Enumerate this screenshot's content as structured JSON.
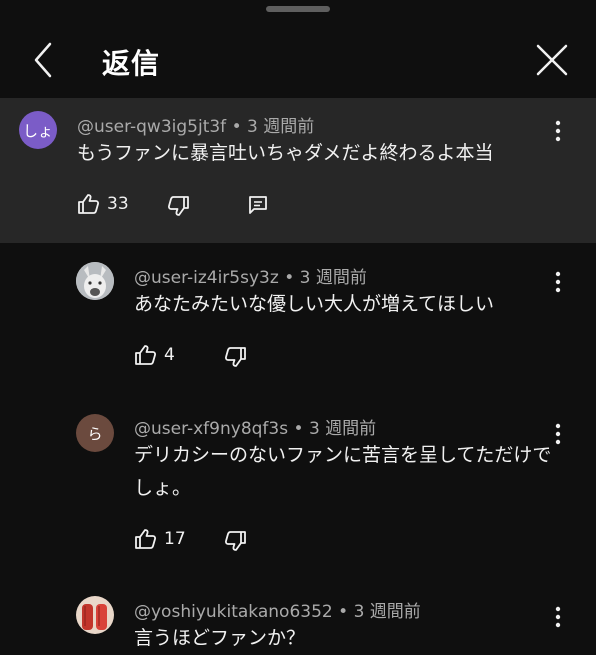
{
  "header": {
    "title": "返信"
  },
  "comments": [
    {
      "author": "@user-qw3ig5jt3f",
      "time": "3 週間前",
      "text": "もうファンに暴言吐いちゃダメだよ終わるよ本当",
      "likes": "33",
      "avatar_text": "しょ",
      "avatar_color": "#7b5cc7"
    },
    {
      "author": "@user-iz4ir5sy3z",
      "time": "3 週間前",
      "text": "あなたみたいな優しい大人が増えてほしい",
      "likes": "4"
    },
    {
      "author": "@user-xf9ny8qf3s",
      "time": "3 週間前",
      "text": "デリカシーのないファンに苦言を呈してただけでしょ。",
      "likes": "17",
      "avatar_text": "ら",
      "avatar_color": "#6b4a3e"
    },
    {
      "author": "@yoshiyukitakano6352",
      "time": "3 週間前",
      "text": "言うほどファンか？"
    }
  ],
  "separator": "•"
}
